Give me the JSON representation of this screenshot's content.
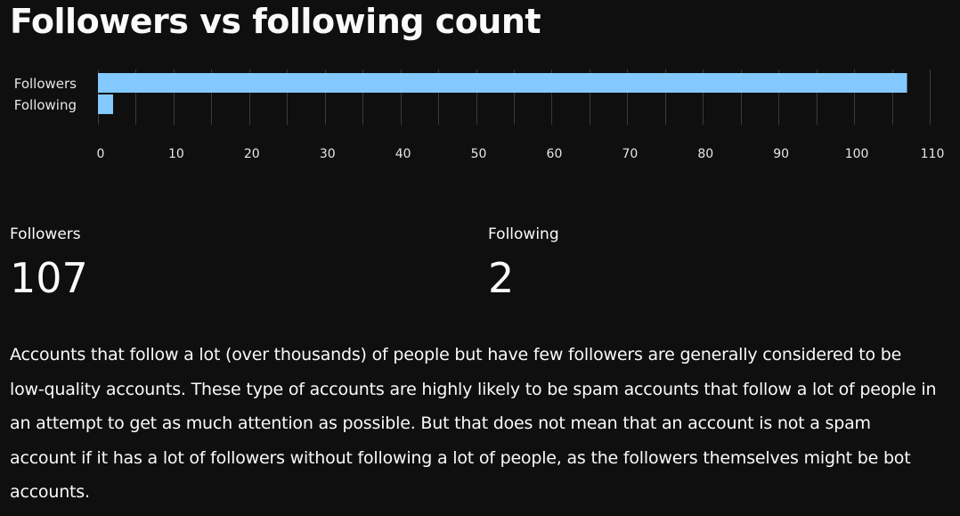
{
  "page": {
    "title": "Followers vs following count"
  },
  "chart_data": {
    "type": "bar",
    "orientation": "horizontal",
    "categories": [
      "Followers",
      "Following"
    ],
    "values": [
      107,
      2
    ],
    "title": "",
    "xlabel": "",
    "ylabel": "",
    "xlim": [
      0,
      110
    ],
    "x_ticks": [
      0,
      10,
      20,
      30,
      40,
      50,
      60,
      70,
      80,
      90,
      100,
      110
    ],
    "grid": true,
    "bar_color": "#83c9ff",
    "text_color": "#e6e6e6",
    "grid_color": "#3a3a3a"
  },
  "metrics": {
    "followers": {
      "label": "Followers",
      "value": "107"
    },
    "following": {
      "label": "Following",
      "value": "2"
    }
  },
  "description": "Accounts that follow a lot (over thousands) of people but have few followers are generally considered to be low-quality accounts. These type of accounts are highly likely to be spam accounts that follow a lot of people in an attempt to get as much attention as possible. But that does not mean that an account is not a spam account if it has a lot of followers without following a lot of people, as the followers themselves might be bot accounts."
}
